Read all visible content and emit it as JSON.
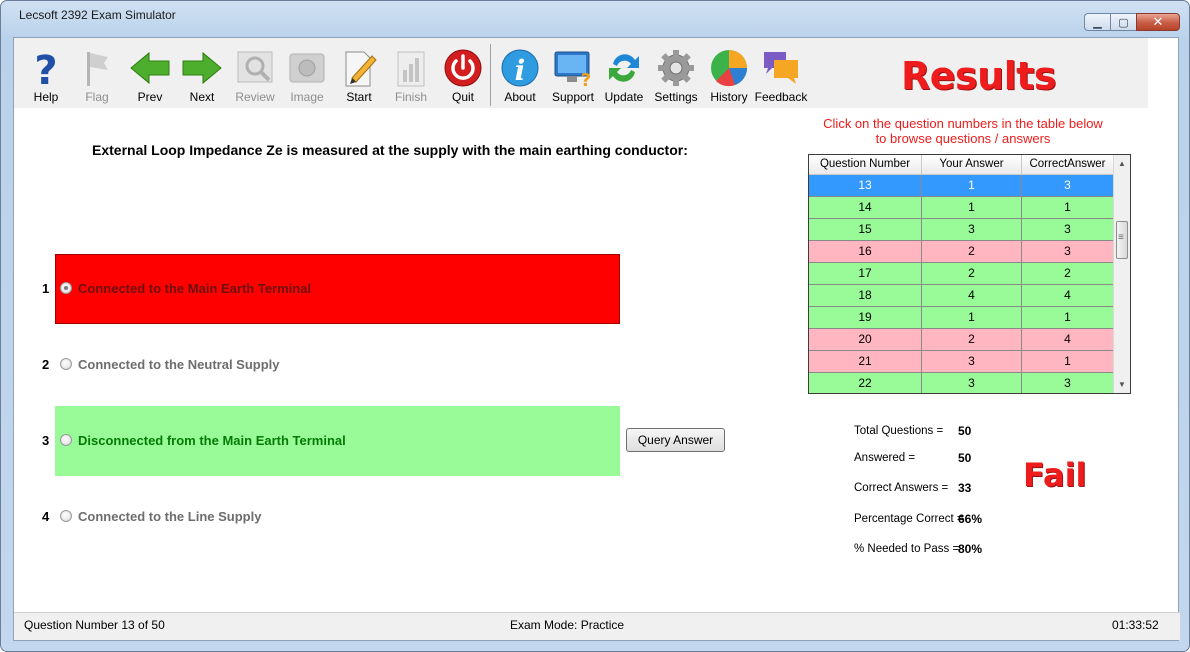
{
  "window": {
    "title": "Lecsoft 2392 Exam Simulator",
    "minimize": "▁",
    "maximize": "▢",
    "close": "✕"
  },
  "toolbar": {
    "items": [
      {
        "label": "Help",
        "icon": "help-icon",
        "enabled": true
      },
      {
        "label": "Flag",
        "icon": "flag-icon",
        "enabled": false
      },
      {
        "label": "Prev",
        "icon": "arrow-left-icon",
        "enabled": true
      },
      {
        "label": "Next",
        "icon": "arrow-right-icon",
        "enabled": true
      },
      {
        "label": "Review",
        "icon": "review-icon",
        "enabled": false
      },
      {
        "label": "Image",
        "icon": "image-icon",
        "enabled": false
      },
      {
        "label": "Start",
        "icon": "start-icon",
        "enabled": true
      },
      {
        "label": "Finish",
        "icon": "finish-icon",
        "enabled": false
      },
      {
        "label": "Quit",
        "icon": "power-icon",
        "enabled": true
      },
      {
        "label": "About",
        "icon": "info-icon",
        "enabled": true
      },
      {
        "label": "Support",
        "icon": "support-icon",
        "enabled": true
      },
      {
        "label": "Update",
        "icon": "update-icon",
        "enabled": true
      },
      {
        "label": "Settings",
        "icon": "gear-icon",
        "enabled": true
      },
      {
        "label": "History",
        "icon": "pie-chart-icon",
        "enabled": true
      },
      {
        "label": "Feedback",
        "icon": "chat-icon",
        "enabled": true
      }
    ]
  },
  "results_title": "Results",
  "question": "External Loop Impedance Ze is measured at the supply with the main earthing conductor:",
  "answers": [
    {
      "number": "1",
      "text": "Connected to the Main Earth Terminal",
      "selected": true,
      "state": "wrong"
    },
    {
      "number": "2",
      "text": "Connected to the Neutral Supply",
      "selected": false,
      "state": "none"
    },
    {
      "number": "3",
      "text": "Disconnected from the Main Earth Terminal",
      "selected": false,
      "state": "correct"
    },
    {
      "number": "4",
      "text": "Connected to the Line Supply",
      "selected": false,
      "state": "none"
    }
  ],
  "query_button": "Query Answer",
  "hint": {
    "line1": "Click on the question numbers in the table below",
    "line2": "to browse questions / answers"
  },
  "results_table": {
    "headers": [
      "Question Number",
      "Your Answer",
      "CorrectAnswer"
    ],
    "rows": [
      {
        "q": "13",
        "your": "1",
        "correct": "3",
        "status": "selected"
      },
      {
        "q": "14",
        "your": "1",
        "correct": "1",
        "status": "correct"
      },
      {
        "q": "15",
        "your": "3",
        "correct": "3",
        "status": "correct"
      },
      {
        "q": "16",
        "your": "2",
        "correct": "3",
        "status": "wrong"
      },
      {
        "q": "17",
        "your": "2",
        "correct": "2",
        "status": "correct"
      },
      {
        "q": "18",
        "your": "4",
        "correct": "4",
        "status": "correct"
      },
      {
        "q": "19",
        "your": "1",
        "correct": "1",
        "status": "correct"
      },
      {
        "q": "20",
        "your": "2",
        "correct": "4",
        "status": "wrong"
      },
      {
        "q": "21",
        "your": "3",
        "correct": "1",
        "status": "wrong"
      },
      {
        "q": "22",
        "your": "3",
        "correct": "3",
        "status": "correct"
      }
    ]
  },
  "stats": {
    "total_label": "Total Questions =",
    "total": "50",
    "answered_label": "Answered =",
    "answered": "50",
    "correct_label": "Correct Answers =",
    "correct": "33",
    "pct_label": "Percentage Correct =",
    "pct": "66%",
    "needed_label": "% Needed to Pass =",
    "needed": "80%"
  },
  "verdict": "Fail",
  "status_bar": {
    "question": "Question Number 13 of 50",
    "mode": "Exam Mode: Practice",
    "time": "01:33:52"
  },
  "colors": {
    "wrong": "#ff0000",
    "correct": "#98fb98",
    "row_wrong": "#ffb6c1",
    "row_correct": "#98fb98",
    "row_selected": "#3399ff",
    "accent_red": "#ee1c1c"
  }
}
